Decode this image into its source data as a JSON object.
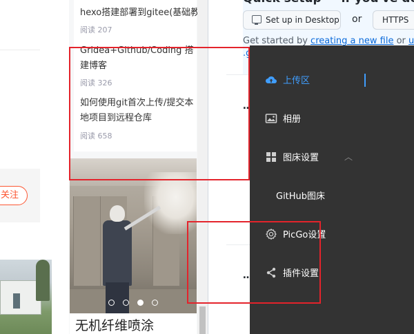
{
  "left": {
    "follow_label": "关注"
  },
  "middle": {
    "articles": [
      {
        "title": "hexo搭建部署到gitee(基础教",
        "read": "阅读 207"
      },
      {
        "title": "Gridea+Github/Coding 搭建博客",
        "read": "阅读 326"
      },
      {
        "title": "如何使用git首次上传/提交本地项目到远程仓库",
        "read": "阅读 658"
      }
    ],
    "carousel": {
      "caption": "无机纤维喷涂",
      "slide_count": 4,
      "active_slide": 3
    }
  },
  "github": {
    "quick_setup": "Quick setup — if you've done",
    "desktop_button": "Set up in Desktop",
    "or_label": "or",
    "https_button": "HTTPS",
    "get_started_prefix": "Get started by ",
    "create_link": "creating a new file",
    "or_upload": " or ",
    "upload_link": "uplo",
    "git_suffix": ".gi",
    "ellipsis_1": "…",
    "ellipsis_2": "…"
  },
  "picgo": {
    "menu": [
      {
        "label": "上传区",
        "icon": "cloud-upload-icon",
        "active": true
      },
      {
        "label": "相册",
        "icon": "image-icon",
        "active": false
      },
      {
        "label": "图床设置",
        "icon": "grid-icon",
        "active": false,
        "expanded": true
      },
      {
        "label": "GitHub图床",
        "submenu": true
      },
      {
        "label": "PicGo设置",
        "icon": "gear-icon",
        "active": false
      },
      {
        "label": "插件设置",
        "icon": "share-icon",
        "active": false
      }
    ],
    "expand_chevron": "︿"
  },
  "colors": {
    "picgo_bg": "#333333",
    "picgo_active": "#409eff",
    "annotation_red": "#e4232b",
    "csdn_orange": "#fc5531",
    "github_link": "#0969da"
  }
}
